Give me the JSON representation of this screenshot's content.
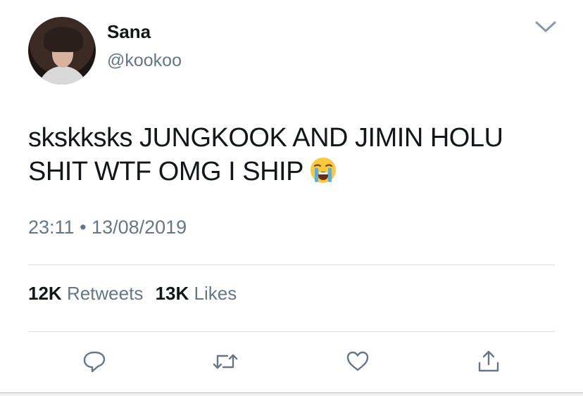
{
  "user": {
    "name": "Sana",
    "handle": "@kookoo"
  },
  "tweet": {
    "text": "skskksks JUNGKOOK AND JIMIN HOLU SHIT WTF OMG I SHIP",
    "emoji": "loudly-crying-face",
    "time": "23:11",
    "separator": "•",
    "date": "13/08/2019"
  },
  "stats": {
    "retweets_count": "12K",
    "retweets_label": "Retweets",
    "likes_count": "13K",
    "likes_label": "Likes"
  },
  "actions": {
    "reply_icon": "reply-icon",
    "retweet_icon": "retweet-icon",
    "like_icon": "heart-icon",
    "share_icon": "share-icon"
  },
  "colors": {
    "text": "#14171a",
    "secondary": "#657786",
    "divider": "#d6dde2",
    "icon": "#657786"
  }
}
